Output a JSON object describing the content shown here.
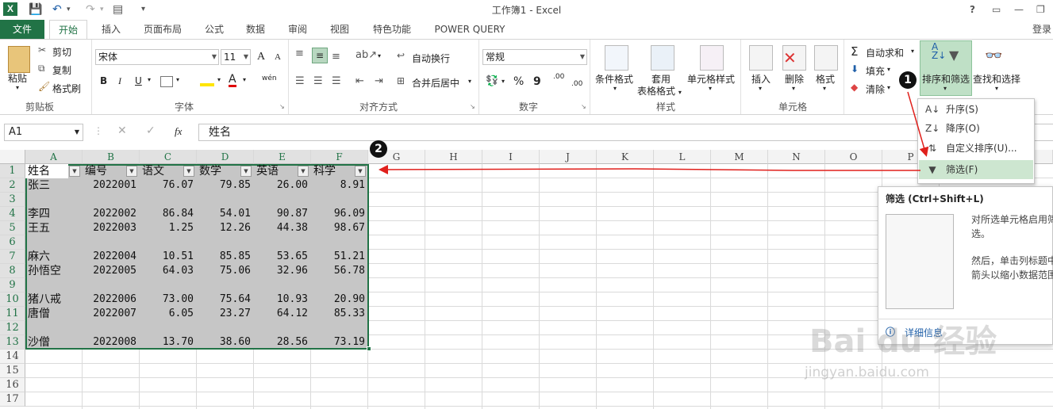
{
  "window": {
    "title": "工作簿1 - Excel",
    "help": "?",
    "minimize": "—",
    "restore": "❐",
    "close": "✕"
  },
  "quick_access": {
    "save_icon": "save-icon",
    "undo_icon": "undo-icon",
    "redo_icon": "redo-icon",
    "customize": "▾"
  },
  "tabs": [
    {
      "label": "文件"
    },
    {
      "label": "开始"
    },
    {
      "label": "插入"
    },
    {
      "label": "页面布局"
    },
    {
      "label": "公式"
    },
    {
      "label": "数据"
    },
    {
      "label": "审阅"
    },
    {
      "label": "视图"
    },
    {
      "label": "特色功能"
    },
    {
      "label": "POWER QUERY"
    }
  ],
  "signin": "登录",
  "ribbon": {
    "clipboard": {
      "paste": "粘贴",
      "cut": "剪切",
      "copy": "复制",
      "format_painter": "格式刷",
      "label": "剪贴板"
    },
    "font": {
      "name": "宋体",
      "size": "11",
      "grow": "A",
      "shrink": "A",
      "bold": "B",
      "italic": "I",
      "underline": "U",
      "font_color": "A",
      "phonetic": "wén",
      "label": "字体"
    },
    "alignment": {
      "wrap": "自动换行",
      "merge": "合并后居中",
      "label": "对齐方式"
    },
    "number": {
      "format": "常规",
      "percent": "%",
      "comma": "9",
      "inc_decimal": ".00",
      "dec_decimal": ".00",
      "label": "数字"
    },
    "styles": {
      "conditional": "条件格式",
      "table1": "套用",
      "table2": "表格格式",
      "cell_styles": "单元格样式",
      "label": "样式"
    },
    "cells": {
      "insert": "插入",
      "delete": "删除",
      "format": "格式",
      "label": "单元格"
    },
    "editing": {
      "autosum": "自动求和",
      "fill": "填充",
      "clear": "清除",
      "sort_filter": "排序和筛选",
      "find_select": "查找和选择",
      "label": "编辑"
    }
  },
  "formula_bar": {
    "name_box": "A1",
    "fx": "fx",
    "content": "姓名"
  },
  "columns": [
    "A",
    "B",
    "C",
    "D",
    "E",
    "F",
    "G",
    "H",
    "I",
    "J",
    "K",
    "L",
    "M",
    "N",
    "O",
    "P"
  ],
  "rows": [
    "1",
    "2",
    "3",
    "4",
    "5",
    "6",
    "7",
    "8",
    "9",
    "10",
    "11",
    "12",
    "13",
    "14",
    "15",
    "16",
    "17"
  ],
  "sheet": {
    "headers": [
      "姓名",
      "编号",
      "语文",
      "数学",
      "英语",
      "科学"
    ],
    "data": [
      {
        "row": 2,
        "name": "张三",
        "id": "2022001",
        "chinese": "76.07",
        "math": "79.85",
        "english": "26.00",
        "science": "8.91"
      },
      {
        "row": 4,
        "name": "李四",
        "id": "2022002",
        "chinese": "86.84",
        "math": "54.01",
        "english": "90.87",
        "science": "96.09"
      },
      {
        "row": 5,
        "name": "王五",
        "id": "2022003",
        "chinese": "1.25",
        "math": "12.26",
        "english": "44.38",
        "science": "98.67"
      },
      {
        "row": 7,
        "name": "麻六",
        "id": "2022004",
        "chinese": "10.51",
        "math": "85.85",
        "english": "53.65",
        "science": "51.21"
      },
      {
        "row": 8,
        "name": "孙悟空",
        "id": "2022005",
        "chinese": "64.03",
        "math": "75.06",
        "english": "32.96",
        "science": "56.78"
      },
      {
        "row": 10,
        "name": "猪八戒",
        "id": "2022006",
        "chinese": "73.00",
        "math": "75.64",
        "english": "10.93",
        "science": "20.90"
      },
      {
        "row": 11,
        "name": "唐僧",
        "id": "2022007",
        "chinese": "6.05",
        "math": "23.27",
        "english": "64.12",
        "science": "85.33"
      },
      {
        "row": 13,
        "name": "沙僧",
        "id": "2022008",
        "chinese": "13.70",
        "math": "38.60",
        "english": "28.56",
        "science": "73.19"
      }
    ]
  },
  "sort_menu": [
    {
      "label": "升序(S)",
      "icon": "sort-ascending-icon"
    },
    {
      "label": "降序(O)",
      "icon": "sort-descending-icon"
    },
    {
      "label": "自定义排序(U)...",
      "icon": "custom-sort-icon"
    },
    {
      "label": "筛选(F)",
      "icon": "filter-icon"
    }
  ],
  "tooltip": {
    "title": "筛选 (Ctrl+Shift+L)",
    "line1": "对所选单元格启用筛",
    "line2": "选。",
    "line3": "然后，单击列标题中",
    "line4": "箭头以缩小数据范围",
    "more_info": "详细信息"
  },
  "annotations": {
    "step1": "1",
    "step2": "2"
  },
  "watermark": {
    "logo": "Bai du 经验",
    "url": "jingyan.baidu.com"
  },
  "colors": {
    "accent": "#217346",
    "selection": "#c6c6c6",
    "arrow": "#e0201c",
    "menu_highlight": "#cde6d0"
  }
}
